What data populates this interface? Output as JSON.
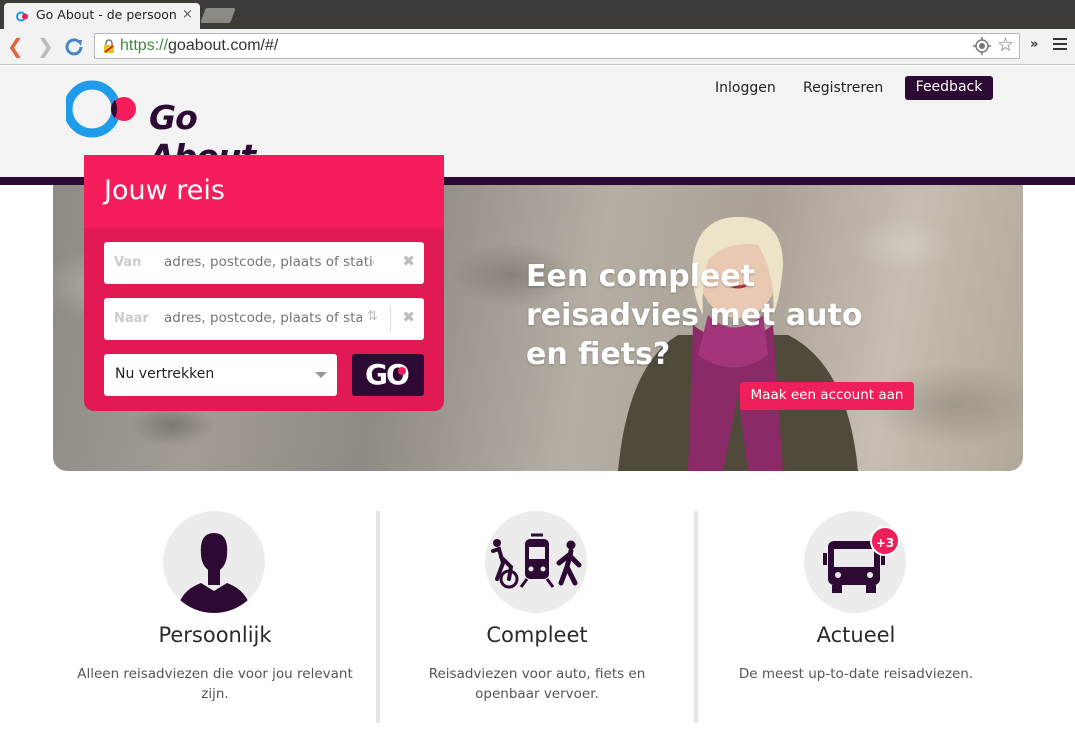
{
  "browser": {
    "tab_title": "Go About - de persoonli",
    "tab_close": "×",
    "url_scheme": "https://",
    "url_rest": "goabout.com/#/",
    "overflow_chevron": "»"
  },
  "header": {
    "logo_text": "Go About",
    "nav": {
      "login": "Inloggen",
      "register": "Registreren",
      "feedback": "Feedback"
    }
  },
  "journey": {
    "title": "Jouw reis",
    "from": {
      "label": "Van",
      "placeholder": "adres, postcode, plaats of station",
      "clear": "✖"
    },
    "to": {
      "label": "Naar",
      "placeholder": "adres, postcode, plaats of station",
      "clear": "✖",
      "swap": "⇅"
    },
    "departure": {
      "selected": "Nu vertrekken"
    },
    "go_label": "GO"
  },
  "hero": {
    "title": "Een compleet reisadvies met auto en fiets?",
    "cta": "Maak een account aan"
  },
  "features": [
    {
      "icon": "person-icon",
      "title": "Persoonlijk",
      "description": "Alleen reisadviezen die voor jou relevant zijn."
    },
    {
      "icon": "bike-train-walk-icon",
      "title": "Compleet",
      "description": "Reisadviezen voor auto, fiets en openbaar vervoer."
    },
    {
      "icon": "bus-icon",
      "title": "Actueel",
      "description": "De meest up-to-date reisadviezen.",
      "badge": "+3"
    }
  ],
  "colors": {
    "brand_dark": "#2d0a33",
    "brand_pink": "#f41c5a",
    "brand_blue": "#1e9be9"
  }
}
